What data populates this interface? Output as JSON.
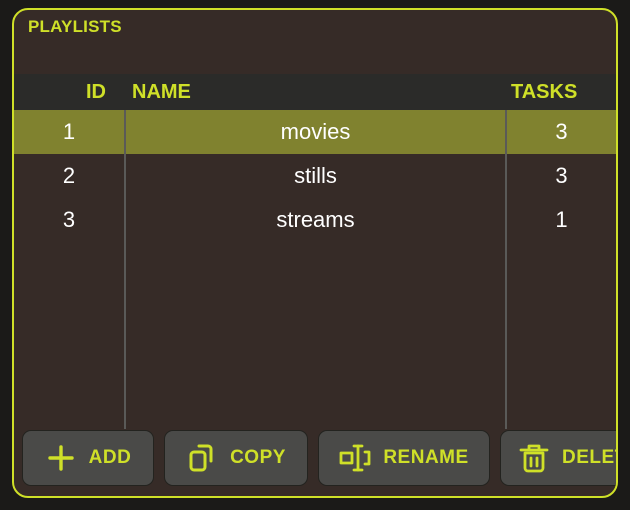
{
  "panel": {
    "title": "PLAYLISTS",
    "border_color": "#cfe028",
    "background_color": "#362b27",
    "accent_color": "#cfe028",
    "selected_row_color": "#80822f"
  },
  "table": {
    "columns": [
      {
        "key": "id",
        "label": "ID"
      },
      {
        "key": "name",
        "label": "NAME"
      },
      {
        "key": "tasks",
        "label": "TASKS"
      }
    ],
    "rows": [
      {
        "id": "1",
        "name": "movies",
        "tasks": "3",
        "selected": true
      },
      {
        "id": "2",
        "name": "stills",
        "tasks": "3",
        "selected": false
      },
      {
        "id": "3",
        "name": "streams",
        "tasks": "1",
        "selected": false
      }
    ]
  },
  "toolbar": {
    "buttons": [
      {
        "label": "ADD",
        "icon": "plus-icon"
      },
      {
        "label": "COPY",
        "icon": "copy-icon"
      },
      {
        "label": "RENAME",
        "icon": "rename-icon"
      },
      {
        "label": "DELETE",
        "icon": "trash-icon"
      }
    ]
  }
}
